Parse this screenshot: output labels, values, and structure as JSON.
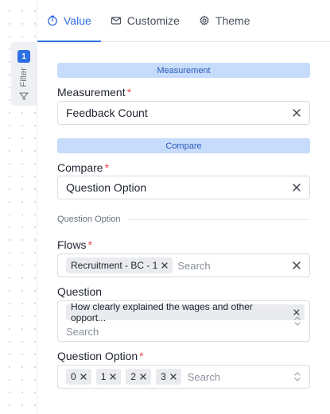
{
  "tabs": [
    {
      "label": "Value",
      "icon": "timer-icon",
      "active": true
    },
    {
      "label": "Customize",
      "icon": "mail-icon",
      "active": false
    },
    {
      "label": "Theme",
      "icon": "gear-icon",
      "active": false
    }
  ],
  "filter": {
    "count": "1",
    "label": "Filter",
    "icon": "funnel-icon"
  },
  "measurement_section": {
    "title": "Measurement"
  },
  "measurement": {
    "label": "Measurement",
    "required_mark": "*",
    "value": "Feedback Count"
  },
  "compare_section": {
    "title": "Compare"
  },
  "compare": {
    "label": "Compare",
    "required_mark": "*",
    "value": "Question Option"
  },
  "question_option_group": {
    "title": "Question Option"
  },
  "flows": {
    "label": "Flows",
    "required_mark": "*",
    "chips": [
      "Recruitment - BC - 1"
    ],
    "placeholder": "Search"
  },
  "question": {
    "label": "Question",
    "chips": [
      "How clearly explained the wages and other opport..."
    ],
    "placeholder": "Search"
  },
  "question_option": {
    "label": "Question Option",
    "required_mark": "*",
    "chips": [
      "0",
      "1",
      "2",
      "3"
    ],
    "placeholder": "Search"
  },
  "colors": {
    "accent": "#2f6fe4",
    "section_bar": "#c7dcfb",
    "required": "#e5484d"
  }
}
